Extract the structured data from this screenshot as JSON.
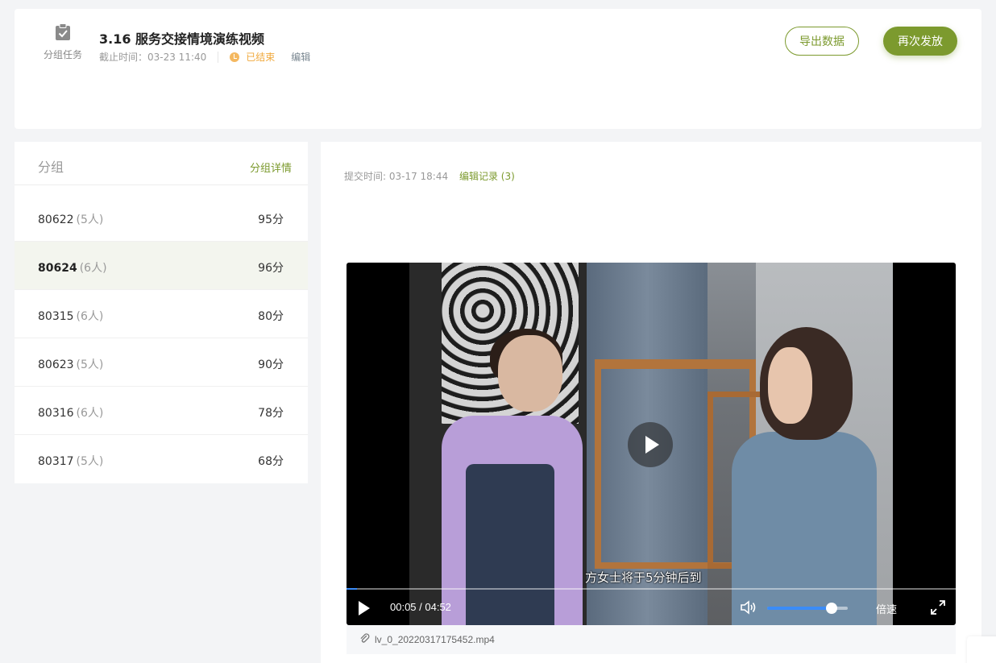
{
  "header": {
    "task_type_label": "分组任务",
    "task_type_icon": "clipboard-check-icon",
    "title": "3.16 服务交接情境演练视频",
    "deadline": "截止时间：03-23 11:40",
    "status": "已结束",
    "status_color": "#f0a93c",
    "edit_label": "编辑",
    "export_label": "导出数据",
    "redistribute_label": "再次发放",
    "accent_color": "#7c9a2e"
  },
  "groups": {
    "title": "分组",
    "detail_label": "分组详情",
    "items": [
      {
        "name": "80622",
        "count": "(5人)",
        "score": "95分"
      },
      {
        "name": "80624",
        "count": "(6人)",
        "score": "96分"
      },
      {
        "name": "80315",
        "count": "(6人)",
        "score": "80分"
      },
      {
        "name": "80623",
        "count": "(5人)",
        "score": "90分"
      },
      {
        "name": "80316",
        "count": "(6人)",
        "score": "78分"
      },
      {
        "name": "80317",
        "count": "(5人)",
        "score": "68分"
      }
    ],
    "active_index": 1
  },
  "submission": {
    "submit_time": "提交时间: 03-17 18:44",
    "edit_records": "编辑记录 (3)",
    "video": {
      "subtitle": "方女士将于5分钟后到",
      "time": "00:05 / 04:52",
      "progress": 0.017,
      "volume": 0.8,
      "speed_label": "倍速"
    },
    "file_name": "lv_0_20220317175452.mp4"
  }
}
